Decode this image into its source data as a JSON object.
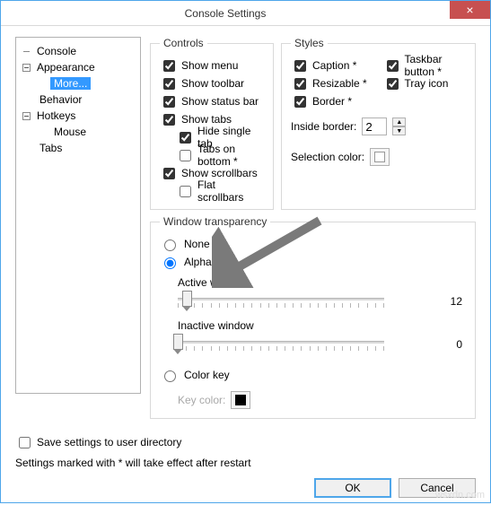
{
  "title": "Console Settings",
  "tree": {
    "console": "Console",
    "appearance": "Appearance",
    "more": "More...",
    "behavior": "Behavior",
    "hotkeys": "Hotkeys",
    "mouse": "Mouse",
    "tabs": "Tabs"
  },
  "controls": {
    "legend": "Controls",
    "show_menu": "Show menu",
    "show_toolbar": "Show toolbar",
    "show_status_bar": "Show status bar",
    "show_tabs": "Show tabs",
    "hide_single_tab": "Hide single tab",
    "tabs_on_bottom": "Tabs on bottom *",
    "show_scrollbars": "Show scrollbars",
    "flat_scrollbars": "Flat scrollbars"
  },
  "styles": {
    "legend": "Styles",
    "caption": "Caption *",
    "taskbar_button": "Taskbar button *",
    "resizable": "Resizable *",
    "tray_icon": "Tray icon",
    "border": "Border *",
    "inside_border": "Inside border:",
    "inside_border_val": "2",
    "selection_color": "Selection color:"
  },
  "transp": {
    "legend": "Window transparency",
    "none": "None",
    "alpha": "Alpha",
    "active": "Active window",
    "inactive": "Inactive window",
    "active_val": "12",
    "inactive_val": "0",
    "colorkey": "Color key",
    "keycolor": "Key color:"
  },
  "bottom": {
    "save_user_dir": "Save settings to user directory",
    "note": "Settings marked with * will take effect after restart",
    "ok": "OK",
    "cancel": "Cancel"
  }
}
